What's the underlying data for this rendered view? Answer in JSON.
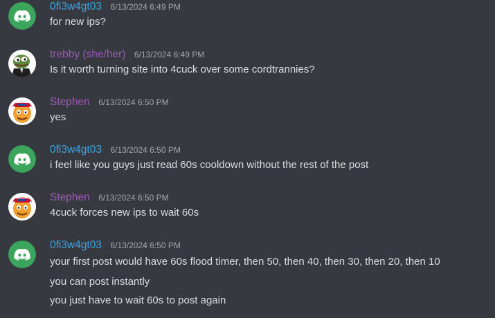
{
  "colors": {
    "background": "#36393f",
    "text": "#dcddde",
    "timestamp": "#a3a6aa",
    "discord_blurple_avatar": "#3ba55c",
    "author_blue": "#3ca3e0",
    "author_purple": "#9b59b6"
  },
  "messages": [
    {
      "author": "0fi3w4gt03",
      "author_color": "#3ca3e0",
      "avatar": "discord-default-avatar-icon",
      "timestamp": "6/13/2024 6:49 PM",
      "lines": [
        "for new ips?"
      ]
    },
    {
      "author": "trebby (she/her)",
      "author_color": "#9b59b6",
      "avatar": "pepe-frog-avatar",
      "timestamp": "6/13/2024 6:49 PM",
      "lines": [
        "Is it worth turning site into 4cuck over some cordtrannies?"
      ]
    },
    {
      "author": "Stephen",
      "author_color": "#9b59b6",
      "avatar": "cartoon-face-avatar",
      "timestamp": "6/13/2024 6:50 PM",
      "lines": [
        "yes"
      ]
    },
    {
      "author": "0fi3w4gt03",
      "author_color": "#3ca3e0",
      "avatar": "discord-default-avatar-icon",
      "timestamp": "6/13/2024 6:50 PM",
      "lines": [
        "i feel like you guys just read 60s cooldown without the rest of the post"
      ]
    },
    {
      "author": "Stephen",
      "author_color": "#9b59b6",
      "avatar": "cartoon-face-avatar",
      "timestamp": "6/13/2024 6:50 PM",
      "lines": [
        "4cuck forces new ips to wait 60s"
      ]
    },
    {
      "author": "0fi3w4gt03",
      "author_color": "#3ca3e0",
      "avatar": "discord-default-avatar-icon",
      "timestamp": "6/13/2024 6:50 PM",
      "lines": [
        "your first post would have 60s flood timer, then 50, then 40, then 30, then 20, then 10",
        "you can post instantly",
        "you just have to wait 60s to post again"
      ]
    }
  ]
}
